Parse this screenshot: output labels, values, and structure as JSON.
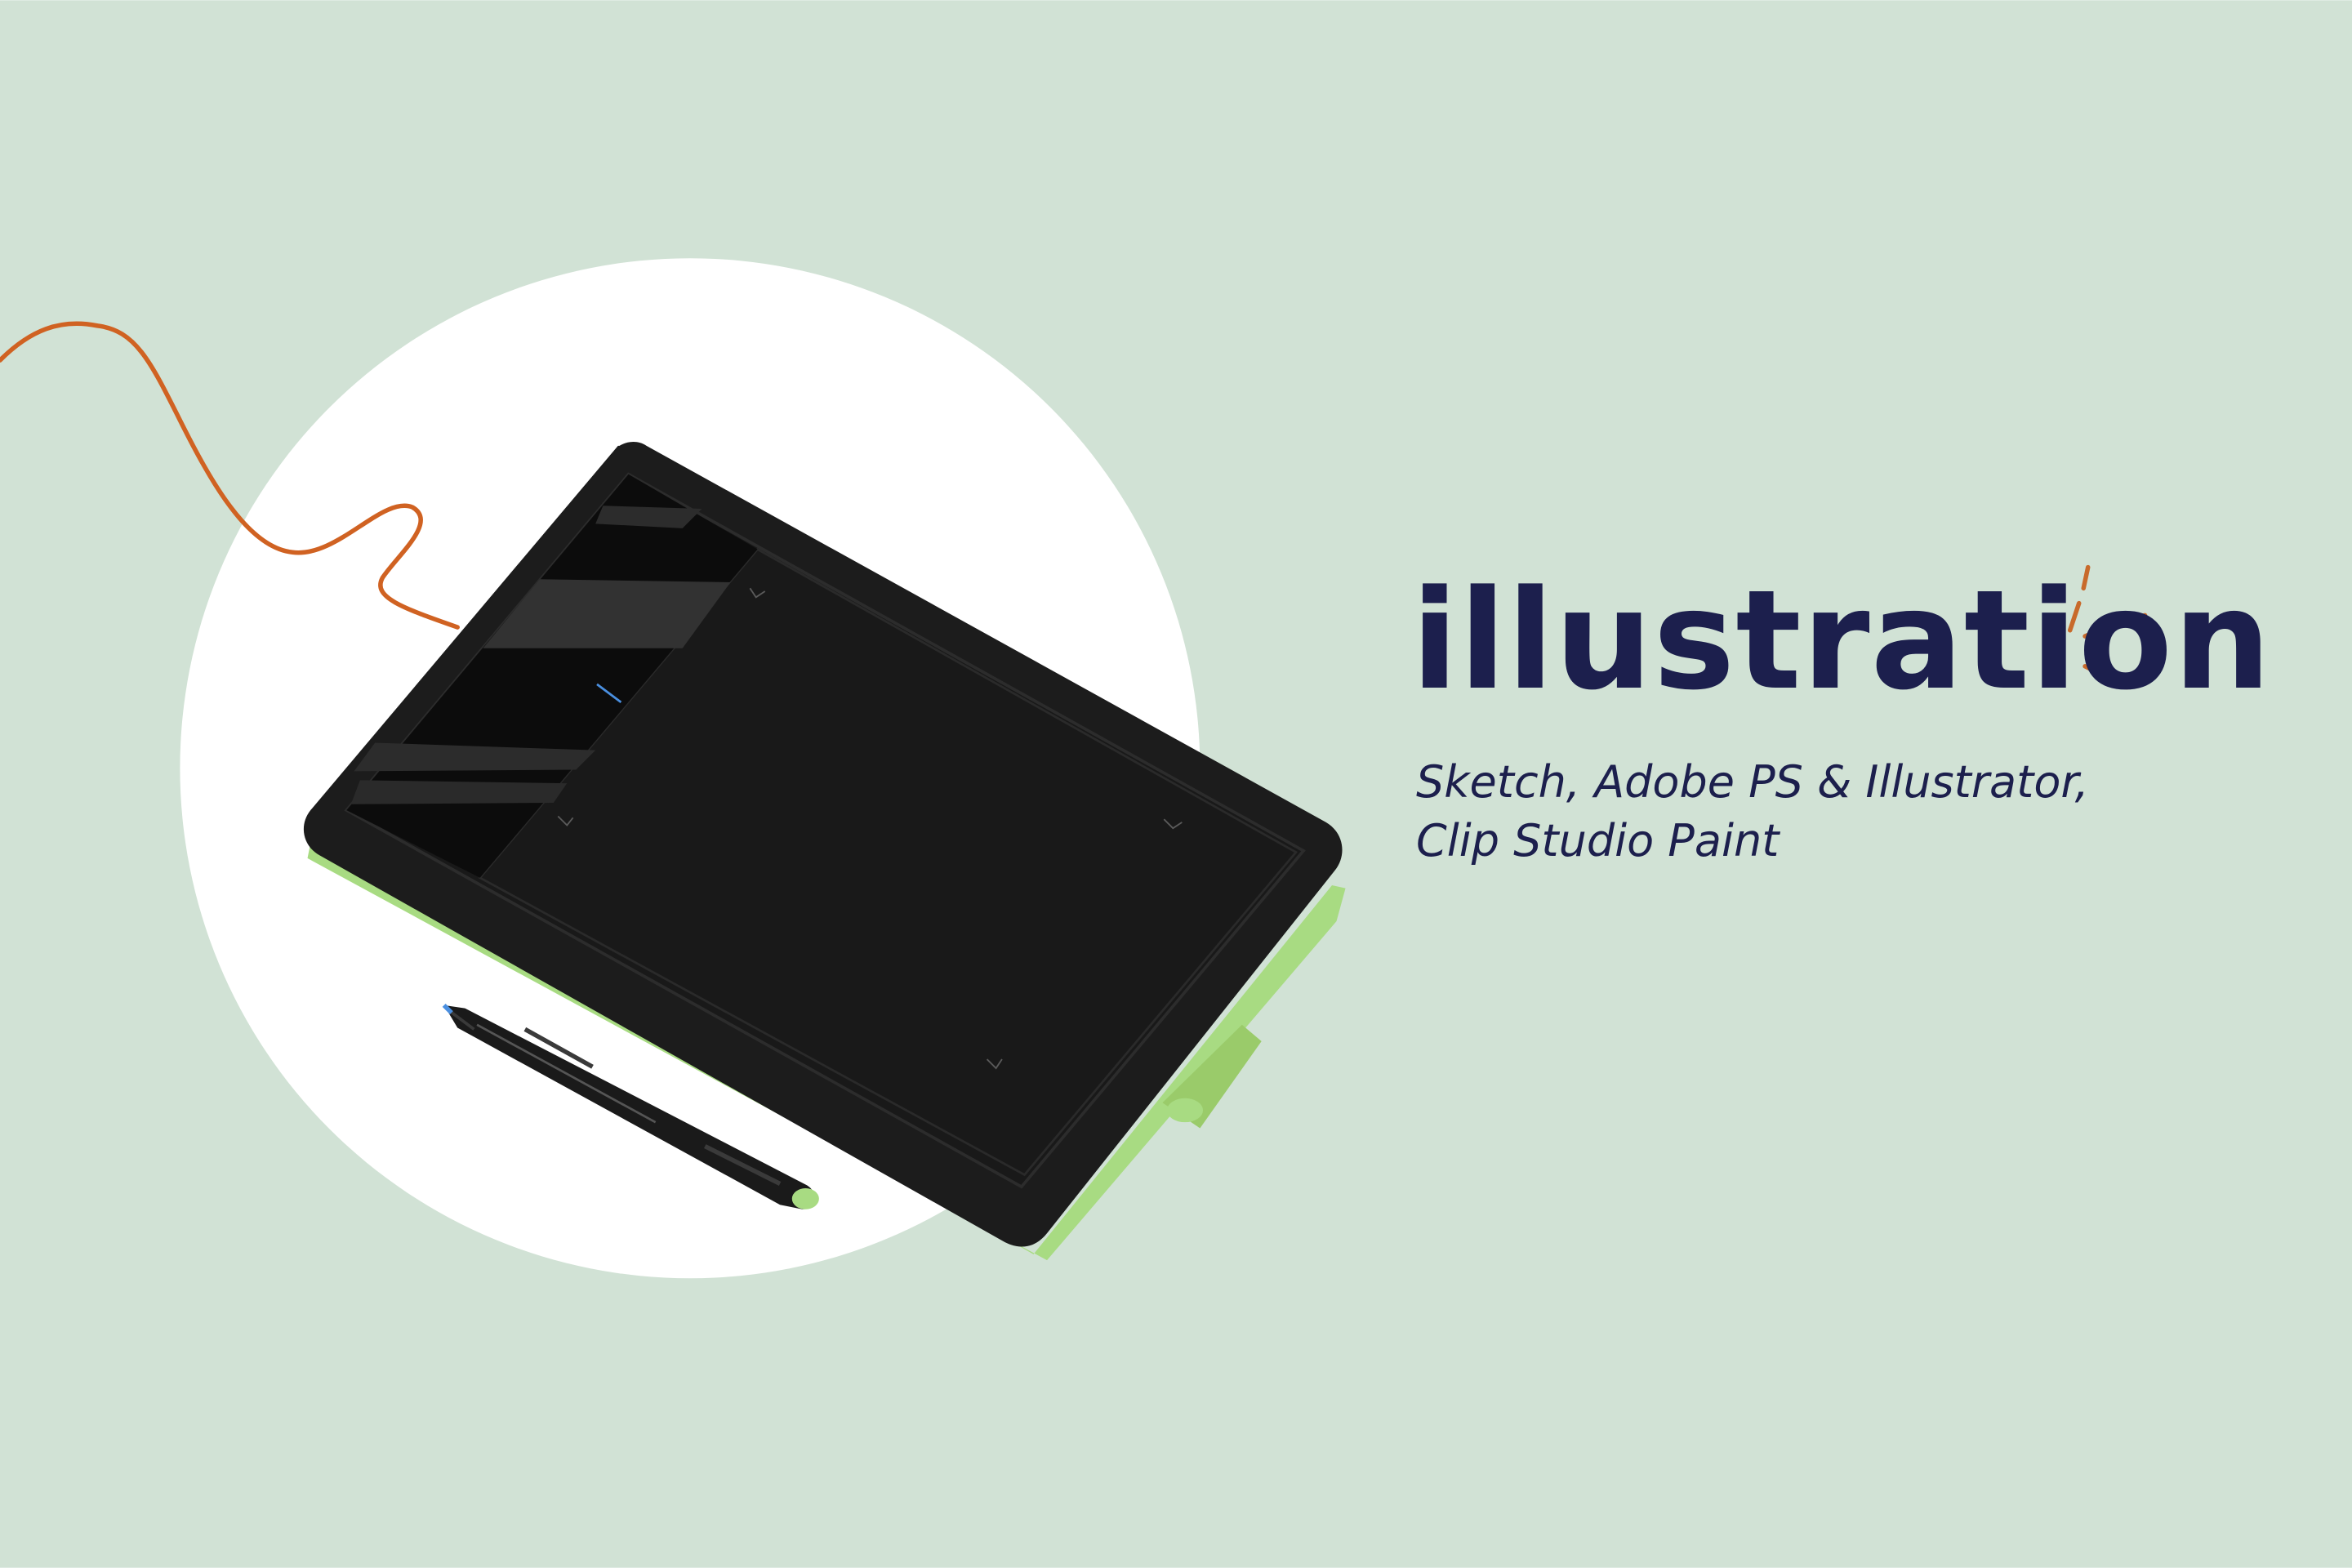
{
  "colors": {
    "background": "#d1e2d5",
    "circle": "#ffffff",
    "tablet_body": "#1c1c1c",
    "tablet_screen": "#191919",
    "tablet_accent": "#a8db82",
    "cable": "#d06222",
    "title_text": "#1c1f4d",
    "sparkle": "#c86a2b"
  },
  "heading": {
    "title": "illustration",
    "subtitle_line1": "Sketch, Adobe PS & Illustrator,",
    "subtitle_line2": "Clip Studio Paint"
  },
  "icons": {
    "tablet": "drawing-tablet-icon",
    "pen": "stylus-pen-icon",
    "cable": "usb-cable-icon",
    "sparkle": "sparkle-icon"
  }
}
